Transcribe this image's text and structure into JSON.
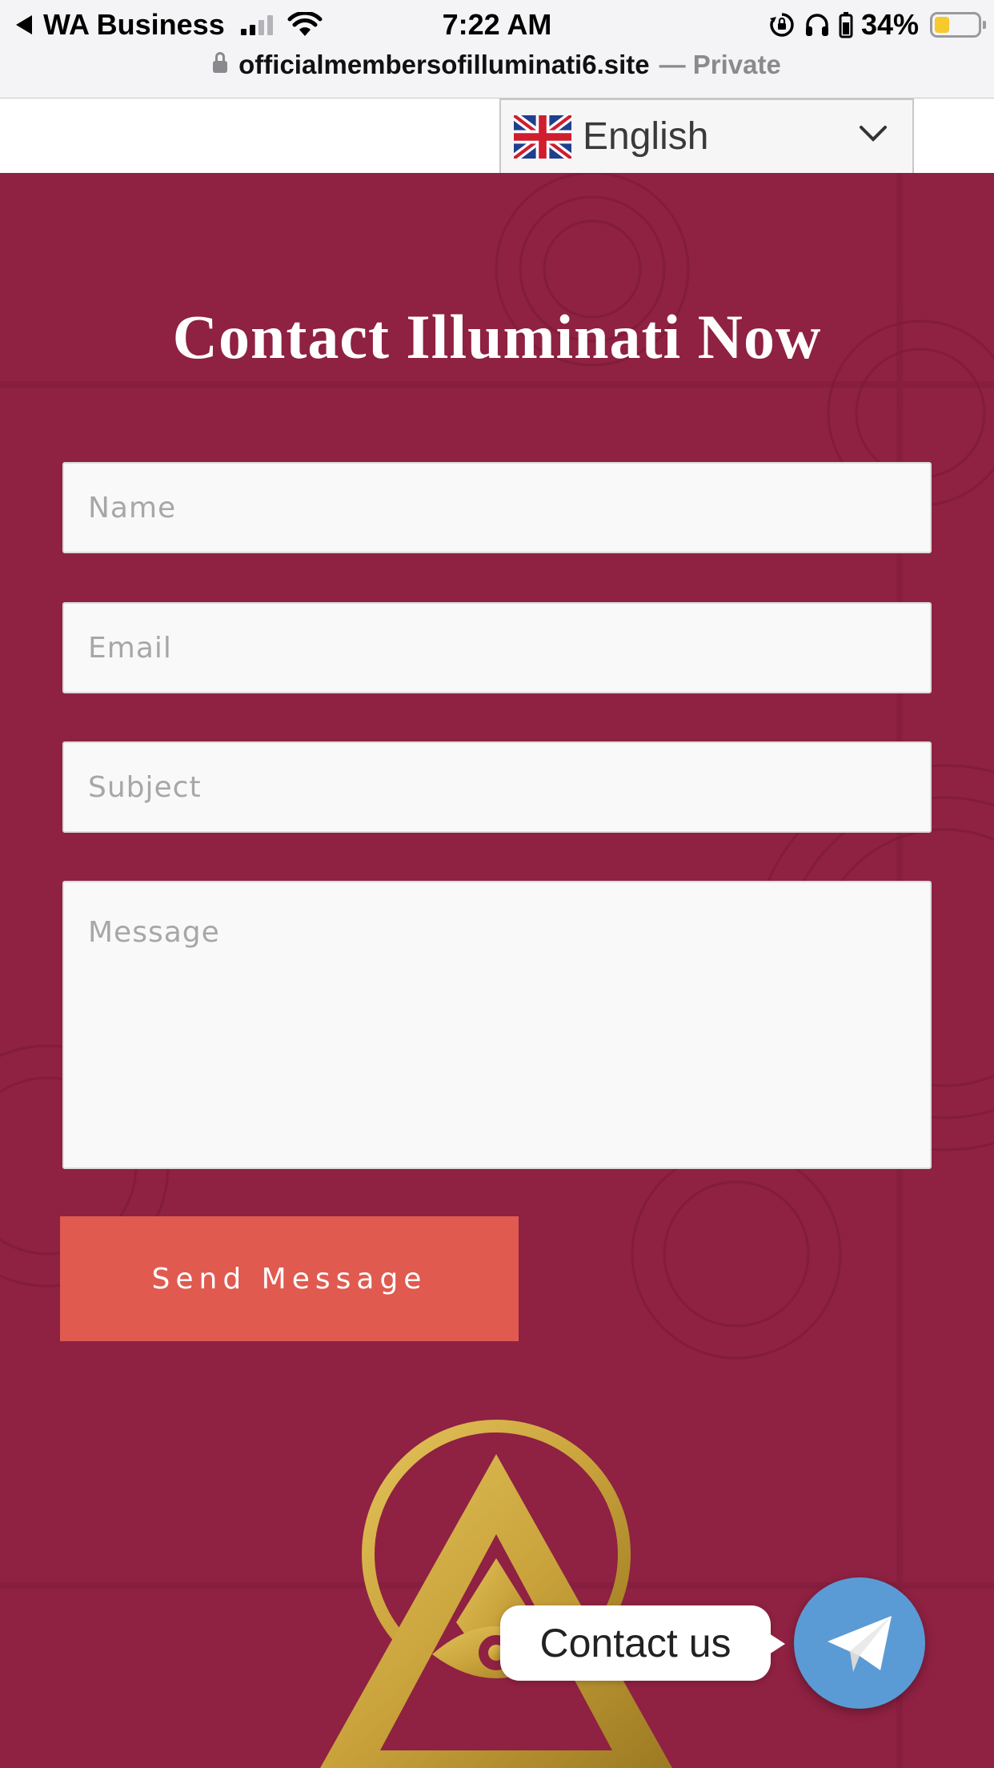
{
  "status_bar": {
    "back_app": "WA Business",
    "time": "7:22 AM",
    "battery_percent": "34%",
    "battery_level": 0.34
  },
  "browser": {
    "domain": "officialmembersofilluminati6.site",
    "mode": "— Private"
  },
  "language_selector": {
    "flag": "uk-flag-icon",
    "selected": "English"
  },
  "contact_form": {
    "title": "Contact Illuminati Now",
    "name_placeholder": "Name",
    "email_placeholder": "Email",
    "subject_placeholder": "Subject",
    "message_placeholder": "Message",
    "submit_label": "Send Message"
  },
  "floating_widget": {
    "label": "Contact us",
    "icon": "telegram-paper-plane-icon"
  },
  "colors": {
    "section_bg": "#8f2142",
    "button_bg": "#e05a50",
    "widget_bg": "#5b9bd5",
    "emblem_gold": "#c9a23b"
  }
}
